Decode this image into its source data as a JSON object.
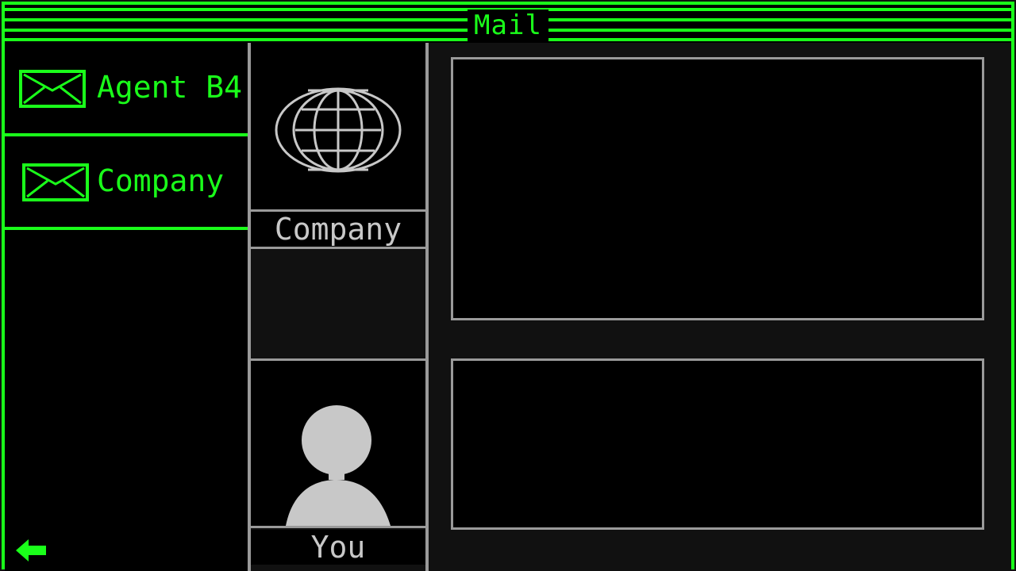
{
  "window": {
    "title": "Mail"
  },
  "inbox": {
    "items": [
      {
        "label": "Agent B4",
        "icon": "envelope-icon"
      },
      {
        "label": "Company",
        "icon": "envelope-icon"
      }
    ],
    "back_icon": "back-arrow-icon"
  },
  "message": {
    "sender_icon": "globe-icon",
    "sender_name": "Company",
    "recipient_icon": "person-silhouette-icon",
    "recipient_name": "You",
    "body_text": "",
    "reply_text": ""
  },
  "colors": {
    "accent": "#1aff1a",
    "panel_gray": "#9a9a9a",
    "text_gray": "#c8c8c8",
    "background": "#000000",
    "dark": "#111111"
  }
}
